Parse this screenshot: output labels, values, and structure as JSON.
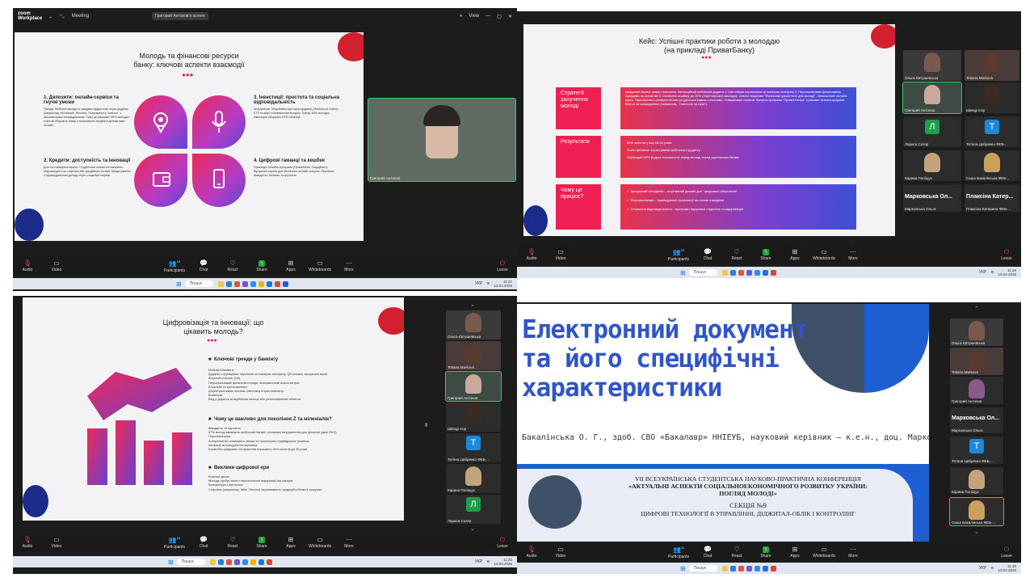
{
  "zoom": {
    "app_name_line1": "zoom",
    "app_name_line2": "Workplace",
    "meeting_label": "Meeting",
    "screen_label": "Григорий Антонов's screen",
    "view_label": "View",
    "controls": {
      "audio": "Audio",
      "video": "Video",
      "participants": "Participants",
      "participants_count_a": "10",
      "participants_count_b": "11",
      "chat": "Chat",
      "react": "React",
      "share": "Share",
      "apps": "Apps",
      "whiteboards": "Whiteboards",
      "more": "More",
      "leave": "Leave"
    }
  },
  "taskbar": {
    "search_placeholder": "Пошук",
    "lang": "УКР",
    "date": "10.04.2025",
    "time_q1": "11:21",
    "time_q2": "11:26",
    "time_q3": "11:22",
    "time_q4": "11:33"
  },
  "q1": {
    "title_line1": "Молодь та фінансові ресурси",
    "title_line2": "банку: ключові аспекти взаємодії",
    "s1_title": "1. Депозити: онлайн-сервіси та гнучкі умови",
    "s1_body": "Тренди: Мобільні вклади зі швидким відкриттям через додатки (наприклад, Monobank, Revolut). Популярність \"копілок\" з автоматичним заощадженням. Чому це важливо: 65% молодих клієнтів обирають банки з можливістю керувати депозитами онлайн.",
    "s2_title": "2. Кредити: доступність та інновації",
    "s2_body": "Для чого використовують: Студентські позики на навчання. Мікрокредити на стартапи або придбання техніки. Кредитування з підтвердженням доходу через соціальні мережі.",
    "s3_title": "3. Інвестиції: простота та соціальна відповідальність",
    "s3_body": "Інструменти: Мікроінвестиції через додатки (Robinhood Online). ETF та акції з мінімальним входом. Тренд: 40% молодих інвесторів обирають ESG-облігації.",
    "s4_title": "4. Цифрові гаманці та кешбек",
    "s4_body": "Приклади: Кешбек-програми (ПриватБанк, ОщадБанк). Віртуальні картки для безпечних онлайн-покупок. Переваги: Швидкість, безпека та зручність.",
    "presenter_name": "Григорий Антонов"
  },
  "q2": {
    "title_line1": "Кейс: Успішні практики роботи з молоддю",
    "title_line2": "(на прикладі ПриватБанку)",
    "row1_label": "Стратегії залучення молоді",
    "row1_body": "Цифровий банкінг нового покоління. Інноваційний мобільний додаток 1. Миттєвими переказами за номером телефону 2. Персональними фінансовими порадами на основі ШІ 3. Системою кешбеку до 30% у партнерських закладах. Освітні ініціативи \"Фінансова грамотність для молоді\" - безкоштовні онлайн-курси. Партнерство з університетами (студентські картки з пільгами). Гейміфікація сервісів: бонусна програма \"ПриватУльтра\" з рівнями та винагородами. Квести за заощадження (наприклад, \"Накопичи на мрію\").",
    "row2_label": "Результати",
    "row2_lines": [
      "60% клієнтів у віці 18-30 років",
      "3 млн активних користувачів мобільного додатку",
      "Найвищий NPS (індекс лояльності) серед молоді серед українських банків"
    ],
    "row3_label": "Чому це працює?",
    "row3_lines": [
      "Зрозумілий інтерфейс – інтуїтивний дизайн для \"цифрових аборигенів\"",
      "Персоналізація – індивідуальні пропозиції на основі поведінки",
      "Соціальна відповідальність – програми підтримки студентів та підприємців"
    ]
  },
  "q3": {
    "title_line1": "Цифровізація та інновації: що",
    "title_line2": "цікавить молодь?",
    "h1": "Ключові тренди у банкінгу",
    "b1": [
      "Мобільні банкінги:",
      "Додатки з функціями: переказів за номером телефону, QR-оплата, віртуальні карти.",
      "Штучний інтелект (ШІ):",
      "Персоналізовані фінансові поради, автоматичний аналіз витрат.",
      "Блокчейн та криптовалюти:",
      "Децентралізовані платежі, інвестиції в криптовалюту.",
      "Біометрія:",
      "Вхід у додаток за відбитком пальця або розпізнаванням обличчя."
    ],
    "h2": "Чому це важливо для покоління Z та міленіалів?",
    "b2": [
      "Швидкість та зручність:",
      "97% молоді вважають мобільний банкінг основним інструментом для фінансів (дані 2023).",
      "Персоналізація:",
      "Алгоритми ШІ аналізують звички та пропонують індивідуальні рішення.",
      "Інновації як конкурентна перевага:",
      "Банки без цифрових інструментів втрачають 40% клієнтів до 35 років."
    ],
    "h3": "Виклики цифрової ери",
    "b3": [
      "Безпека даних:",
      "Молодь турбує захист персональної інформації від хакерів.",
      "Конкуренція з фінтехом:",
      "Стартапи (наприклад, Wise, Revolut) переманюють традиційні банки в пошуках!"
    ]
  },
  "q4": {
    "title_line1": "Електронний документ",
    "title_line2": "та його специфічні",
    "title_line3": "характеристики",
    "author": "Бакалінська О. Г., здоб. СВО «Бакалавр» ННІЕУБ, науковий керівник – к.е.н., доц. Маркова Т. Д.",
    "conf_line1": "VII ВСЕУКРАЇНСЬКА СТУДЕНТСЬКА НАУКОВО-ПРАКТИЧНА КОНФЕРЕНЦІЯ",
    "conf_line2": "«АКТУАЛЬНІ АСПЕКТИ СОЦІАЛЬНОЕКОНОМІЧНОГО РОЗВИТКУ УКРАЇНИ:",
    "conf_line3": "ПОГЛЯД МОЛОДІ»",
    "section": "СЕКЦІЯ №9",
    "section_title": "ЦИФРОВІ ТЕХНОЛОГІЇ В УПРАВЛІННІ, ДІДЖИТАЛ-ОБЛІК І КОНТРОЛІНГ"
  },
  "participants": {
    "olga": "Ольга Євтушевська",
    "tetiana": "Tetiana Markova",
    "hryhorii": "Григорий Антонов",
    "shvets": "Швецр Ігор",
    "larysa": "Лариса Скляр",
    "tetiana_ts": "Тетяна Цебренко ФЕБ-...",
    "karyna": "Карина Поліщук",
    "sasha": "Саша Бакалінська ФЕБ-...",
    "markovska_big": "Марковська Ол...",
    "markovska": "Марковська Ольга",
    "plaksina_big": "Плаксіна Катер...",
    "plaksina": "Плаксіна Катерина ФЕБ-...",
    "letter_l": "Л",
    "letter_t": "Т"
  }
}
